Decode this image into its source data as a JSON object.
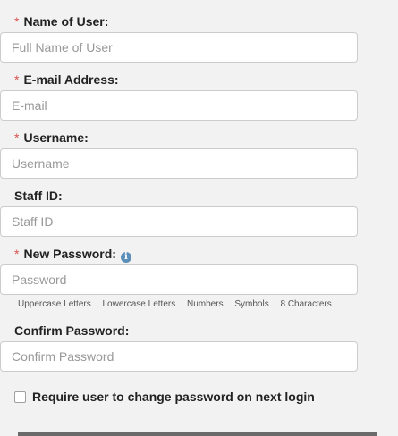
{
  "required_marker": "*",
  "fields": {
    "name": {
      "label": "Name of User:",
      "placeholder": "Full Name of User",
      "required": true
    },
    "email": {
      "label": "E-mail Address:",
      "placeholder": "E-mail",
      "required": true
    },
    "username": {
      "label": "Username:",
      "placeholder": "Username",
      "required": true
    },
    "staff_id": {
      "label": "Staff ID:",
      "placeholder": "Staff ID",
      "required": false
    },
    "new_password": {
      "label": "New Password:",
      "placeholder": "Password",
      "required": true,
      "info_icon": "info-icon"
    },
    "confirm_password": {
      "label": "Confirm Password:",
      "placeholder": "Confirm Password",
      "required": false
    }
  },
  "password_requirements": [
    "Uppercase Letters",
    "Lowercase Letters",
    "Numbers",
    "Symbols",
    "8 Characters"
  ],
  "checkbox": {
    "label": "Require user to change password on next login",
    "checked": false
  },
  "colors": {
    "required": "#d9534f",
    "info_icon": "#5b8fb9",
    "background": "#f2f2f2"
  }
}
